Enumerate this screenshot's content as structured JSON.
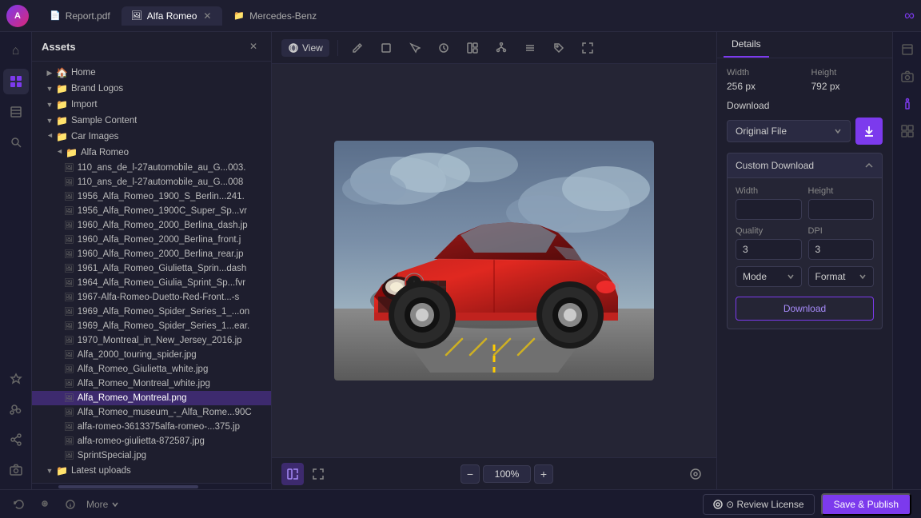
{
  "app": {
    "title": "Assets",
    "logo": "∞"
  },
  "tabs": [
    {
      "id": "report",
      "label": "Report.pdf",
      "icon": "📄",
      "active": false,
      "closable": true
    },
    {
      "id": "alfa",
      "label": "Alfa Romeo",
      "icon": "🖼",
      "active": true,
      "closable": true
    },
    {
      "id": "mercedes",
      "label": "Mercedes-Benz",
      "icon": "📁",
      "active": false,
      "closable": false
    }
  ],
  "toolbar": {
    "view_label": "View"
  },
  "sidebar_icons": [
    {
      "id": "home",
      "icon": "⌂",
      "active": false
    },
    {
      "id": "grid",
      "icon": "⊞",
      "active": false
    },
    {
      "id": "layers",
      "icon": "◫",
      "active": false
    },
    {
      "id": "search",
      "icon": "⌕",
      "active": false
    }
  ],
  "asset_tree": {
    "header": "Assets",
    "items": [
      {
        "id": "home",
        "label": "Home",
        "type": "folder",
        "indent": 0,
        "expanded": false
      },
      {
        "id": "brand-logos",
        "label": "Brand Logos",
        "type": "folder",
        "indent": 1,
        "expanded": false
      },
      {
        "id": "import",
        "label": "Import",
        "type": "folder",
        "indent": 1,
        "expanded": false
      },
      {
        "id": "sample-content",
        "label": "Sample Content",
        "type": "folder",
        "indent": 1,
        "expanded": false
      },
      {
        "id": "car-images",
        "label": "Car Images",
        "type": "folder",
        "indent": 1,
        "expanded": true
      },
      {
        "id": "alfa-romeo",
        "label": "Alfa Romeo",
        "type": "folder",
        "indent": 2,
        "expanded": true
      },
      {
        "id": "file1",
        "label": "110_ans_de_l-27automobile_au_G...003.",
        "type": "image",
        "indent": 3
      },
      {
        "id": "file2",
        "label": "110_ans_de_l-27automobile_au_G...008",
        "type": "image",
        "indent": 3
      },
      {
        "id": "file3",
        "label": "1956_Alfa_Romeo_1900_S_Berlin...241.",
        "type": "image",
        "indent": 3
      },
      {
        "id": "file4",
        "label": "1956_Alfa_Romeo_1900C_Super_Sp...vr",
        "type": "image",
        "indent": 3
      },
      {
        "id": "file5",
        "label": "1960_Alfa_Romeo_2000_Berlina_dash.jp",
        "type": "image",
        "indent": 3
      },
      {
        "id": "file6",
        "label": "1960_Alfa_Romeo_2000_Berlina_front.j",
        "type": "image",
        "indent": 3
      },
      {
        "id": "file7",
        "label": "1960_Alfa_Romeo_2000_Berlina_rear.jp",
        "type": "image",
        "indent": 3
      },
      {
        "id": "file8",
        "label": "1961_Alfa_Romeo_Giulietta_Sprin...dash",
        "type": "image",
        "indent": 3
      },
      {
        "id": "file9",
        "label": "1964_Alfa_Romeo_Giulia_Sprint_Sp...fvr",
        "type": "image",
        "indent": 3
      },
      {
        "id": "file10",
        "label": "1967-Alfa-Romeo-Duetto-Red-Front...-s",
        "type": "image",
        "indent": 3
      },
      {
        "id": "file11",
        "label": "1969_Alfa_Romeo_Spider_Series_1_...on",
        "type": "image",
        "indent": 3
      },
      {
        "id": "file12",
        "label": "1969_Alfa_Romeo_Spider_Series_1...ear.",
        "type": "image",
        "indent": 3
      },
      {
        "id": "file13",
        "label": "1970_Montreal_in_New_Jersey_2016.jp",
        "type": "image",
        "indent": 3
      },
      {
        "id": "file14",
        "label": "Alfa_2000_touring_spider.jpg",
        "type": "image",
        "indent": 3
      },
      {
        "id": "file15",
        "label": "Alfa_Romeo_Giulietta_white.jpg",
        "type": "image",
        "indent": 3
      },
      {
        "id": "file16",
        "label": "Alfa_Romeo_Montreal_white.jpg",
        "type": "image",
        "indent": 3
      },
      {
        "id": "file17",
        "label": "Alfa_Romeo_Montreal.png",
        "type": "image",
        "indent": 3,
        "selected": true
      },
      {
        "id": "file18",
        "label": "Alfa_Romeo_museum_-_Alfa_Rome...90C",
        "type": "image",
        "indent": 3
      },
      {
        "id": "file19",
        "label": "alfa-romeo-3613375alfa-romeo-...375.jp",
        "type": "image",
        "indent": 3
      },
      {
        "id": "file20",
        "label": "alfa-romeo-giulietta-872587.jpg",
        "type": "image",
        "indent": 3
      },
      {
        "id": "file21",
        "label": "SprintSpecial.jpg",
        "type": "image",
        "indent": 3
      },
      {
        "id": "latest-uploads",
        "label": "Latest uploads",
        "type": "folder",
        "indent": 1,
        "expanded": false
      }
    ]
  },
  "canvas": {
    "zoom": "100%",
    "image_alt": "Alfa Romeo Montreal red car"
  },
  "details": {
    "tab_label": "Details",
    "width_label": "Width",
    "height_label": "Height",
    "width_value": "256 px",
    "height_value": "792 px",
    "download_label": "Download",
    "download_option": "Original File",
    "custom_download_label": "Custom Download",
    "custom_download_expanded": true,
    "width_field_label": "Width",
    "height_field_label": "Height",
    "quality_label": "Quality",
    "quality_value": "3",
    "dpi_label": "DPI",
    "dpi_value": "3",
    "mode_label": "Mode",
    "format_label": "Format",
    "download_btn_label": "Download"
  },
  "bottom_bar": {
    "review_btn_label": "⊙ Review License",
    "publish_btn_label": "Save & Publish"
  }
}
